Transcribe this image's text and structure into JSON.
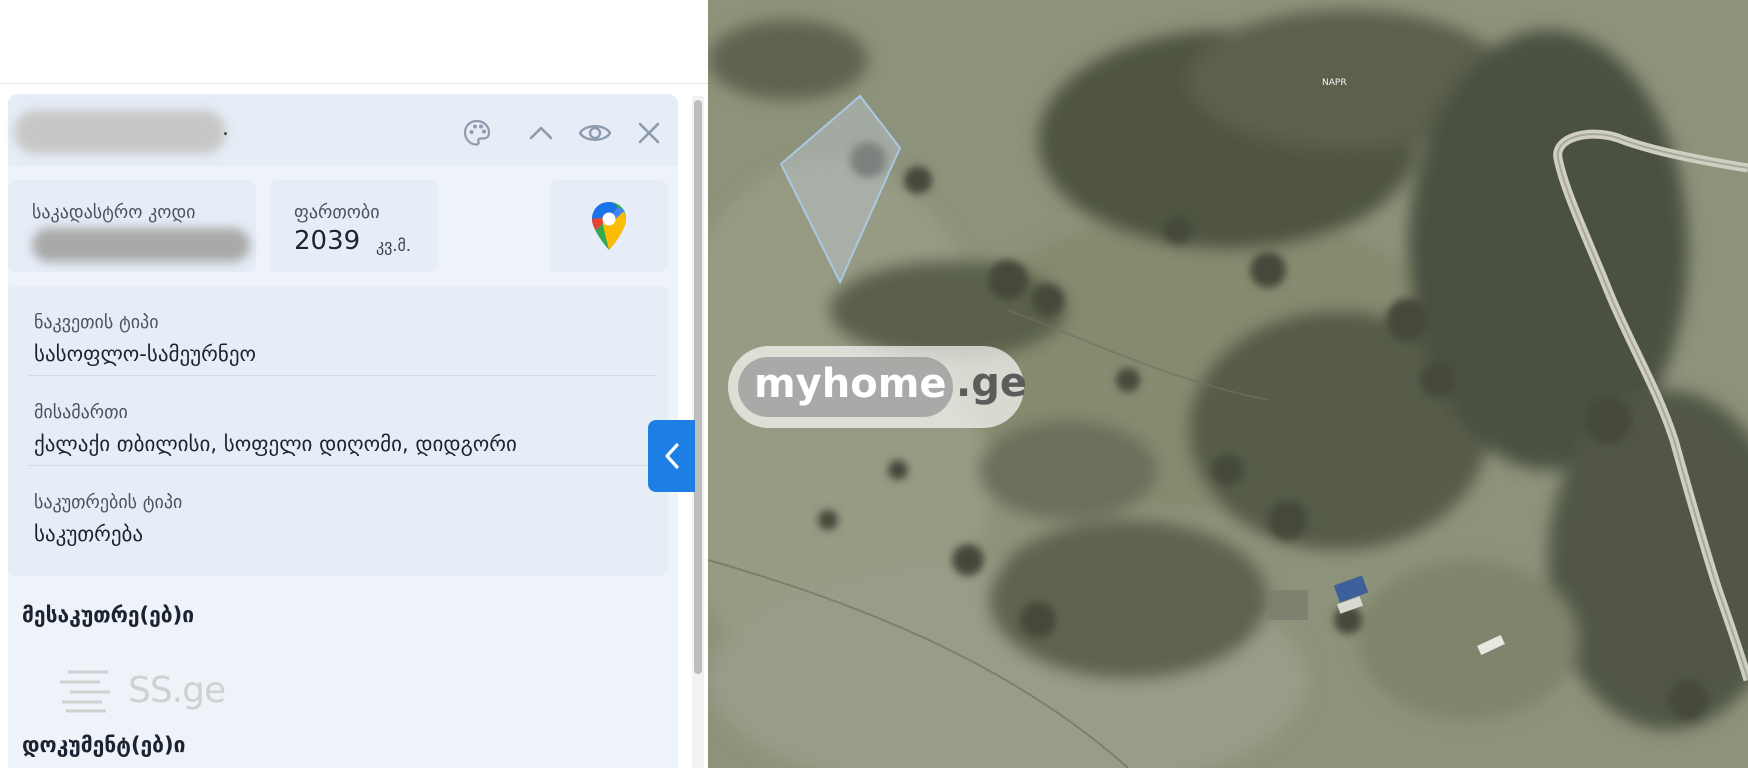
{
  "card_header": {
    "name_suffix": "."
  },
  "cadastral": {
    "label": "საკადასტრო კოდი"
  },
  "area": {
    "label": "ფართობი",
    "value": "2039",
    "unit": "კვ.მ."
  },
  "maps": {
    "icon": "google-maps-pin-icon"
  },
  "details": [
    {
      "label": "ნაკვეთის ტიპი",
      "value": "სასოფლო-სამეურნეო"
    },
    {
      "label": "მისამართი",
      "value": "ქალაქი თბილისი, სოფელი დიღომი, დიდგორი"
    },
    {
      "label": "საკუთრების ტიპი",
      "value": "საკუთრება"
    }
  ],
  "sections": {
    "owners": "მესაკუთრე(ებ)ი",
    "documents": "დოკუმენტ(ებ)ი"
  },
  "watermarks": {
    "ss": "SS.ge",
    "myhome": "myhome",
    "myhome_tld": ".ge"
  },
  "map": {
    "label": "NAPR"
  },
  "colors": {
    "accent": "#1d7fe3",
    "card_bg": "#e6edf7",
    "map_base": "#8e9379"
  }
}
